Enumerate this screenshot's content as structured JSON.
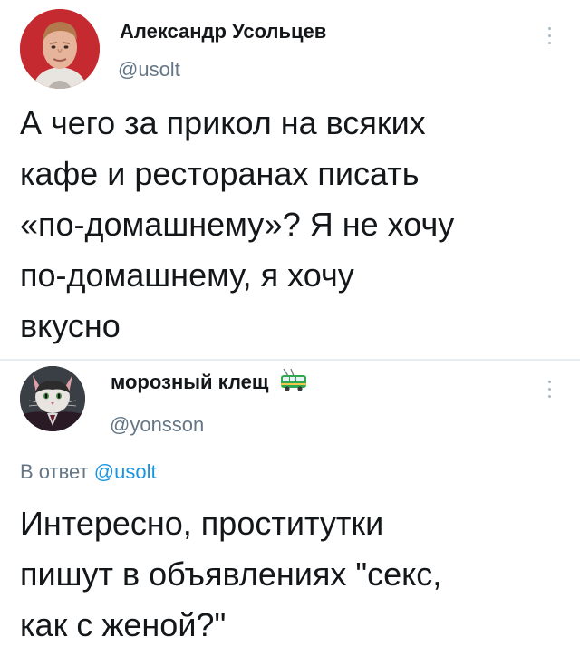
{
  "tweets": [
    {
      "author": {
        "display_name": "Александр Усольцев",
        "handle": "@usolt"
      },
      "text_lines": [
        "А чего за прикол на всяких",
        "кафе и ресторанах писать",
        "«по-домашнему»? Я не хочу",
        "по-домашнему, я хочу",
        "вкусно"
      ],
      "more_icon": "vertical-ellipsis-icon"
    },
    {
      "author": {
        "display_name": "морозный клещ",
        "handle": "@yonsson",
        "name_emoji": "trolleybus-emoji"
      },
      "reply_to": {
        "prefix": "В ответ",
        "handle": "@usolt"
      },
      "text_lines": [
        "Интересно, проститутки",
        "пишут в объявлениях \"секс,",
        "как с женой?\""
      ],
      "more_icon": "vertical-ellipsis-icon"
    }
  ],
  "colors": {
    "text": "#14171a",
    "secondary": "#657786",
    "link": "#1b95e0",
    "divider": "#e6ecf0"
  }
}
